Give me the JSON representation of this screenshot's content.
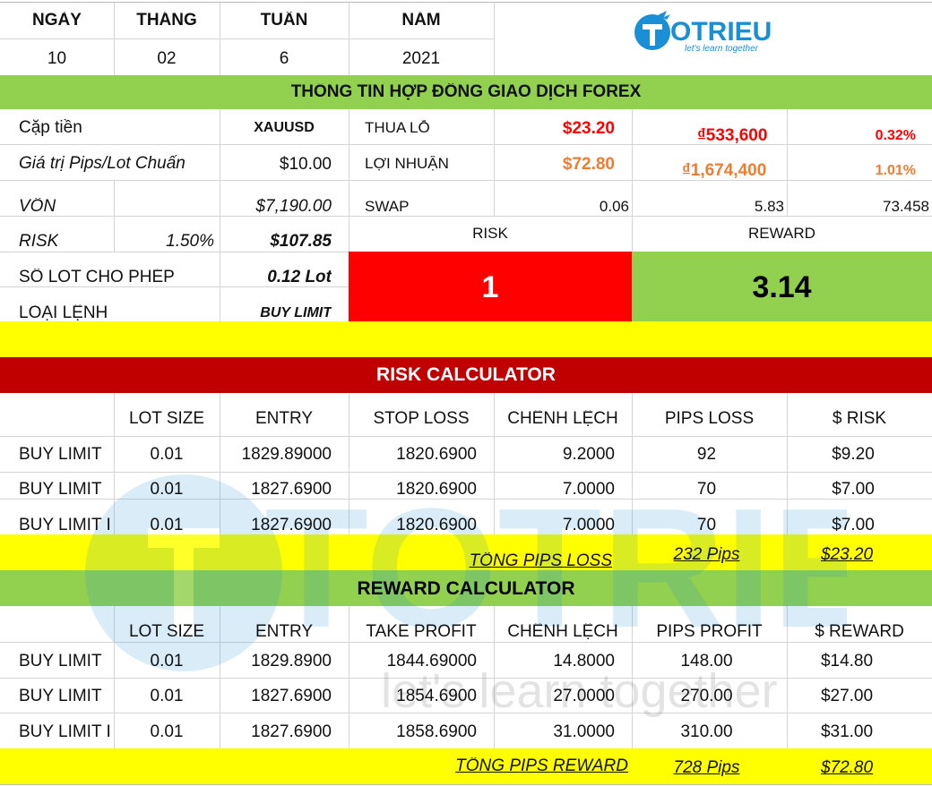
{
  "date": {
    "headers": [
      "NGÀY",
      "THÁNG",
      "TUẦN",
      "NĂM"
    ],
    "values": [
      "10",
      "02",
      "6",
      "2021"
    ]
  },
  "logo": {
    "name": "OTRIEU",
    "tagline": "let's learn together",
    "watermark_name": "TOTRIEU",
    "watermark_tagline": "let's learn together"
  },
  "contract": {
    "title": "THÔNG TIN HỢP ĐỒNG GIAO DỊCH FOREX",
    "pair_label": "Cặp tiền",
    "pair_value": "XAUUSD",
    "pip_label": "Giá trị Pips/Lot Chuẩn",
    "pip_value": "$10.00",
    "capital_label": "VỐN",
    "capital_value": "$7,190.00",
    "risk_label": "RISK",
    "risk_pct": "1.50%",
    "risk_value": "$107.85",
    "lot_label": "SỐ LOT CHO PHÉP",
    "lot_value": "0.12 Lot",
    "order_label": "LOẠI LỆNH",
    "order_value": "BUY LIMIT",
    "loss_label": "THUA LỖ",
    "loss_usd": "$23.20",
    "loss_vnd": "₫533,600",
    "loss_pct": "0.32%",
    "profit_label": "LỢI NHUẬN",
    "profit_usd": "$72.80",
    "profit_vnd": "₫1,674,400",
    "profit_pct": "1.01%",
    "swap_label": "SWAP",
    "swap_1": "0.06",
    "swap_2": "5.83",
    "swap_3": "73.458",
    "rr_risk_label": "RISK",
    "rr_reward_label": "REWARD",
    "rr_risk_value": "1",
    "rr_reward_value": "3.14"
  },
  "risk_calc": {
    "title": "RISK CALCULATOR",
    "headers": [
      "LOT SIZE",
      "ENTRY",
      "STOP LOSS",
      "CHÊNH LỆCH",
      "PIPS LOSS",
      "$ RISK"
    ],
    "rows": [
      [
        "BUY LIMIT",
        "0.01",
        "1829.89000",
        "1820.6900",
        "9.2000",
        "92",
        "$9.20"
      ],
      [
        "BUY LIMIT",
        "0.01",
        "1827.6900",
        "1820.6900",
        "7.0000",
        "70",
        "$7.00"
      ],
      [
        "BUY LIMIT I",
        "0.01",
        "1827.6900",
        "1820.6900",
        "7.0000",
        "70",
        "$7.00"
      ]
    ],
    "total_label": "TỔNG PIPS LOSS",
    "total_pips": "232 Pips",
    "total_usd": "$23.20"
  },
  "reward_calc": {
    "title": "REWARD CALCULATOR",
    "headers": [
      "LOT SIZE",
      "ENTRY",
      "TAKE PROFIT",
      "CHÊNH LỆCH",
      "PIPS PROFIT",
      "$ REWARD"
    ],
    "rows": [
      [
        "BUY LIMIT",
        "0.01",
        "1829.8900",
        "1844.69000",
        "14.8000",
        "148.00",
        "$14.80"
      ],
      [
        "BUY LIMIT",
        "0.01",
        "1827.6900",
        "1854.6900",
        "27.0000",
        "270.00",
        "$27.00"
      ],
      [
        "BUY LIMIT I",
        "0.01",
        "1827.6900",
        "1858.6900",
        "31.0000",
        "310.00",
        "$31.00"
      ]
    ],
    "total_label": "TỔNG PIPS REWARD",
    "total_pips": "728 Pips",
    "total_usd": "$72.80"
  },
  "colors": {
    "green": "#92d050",
    "yellow": "#ffff00",
    "red": "#ff0000",
    "dark_red": "#c00000",
    "orange": "#ed7d31",
    "logo_blue": "#1b8fd6"
  }
}
